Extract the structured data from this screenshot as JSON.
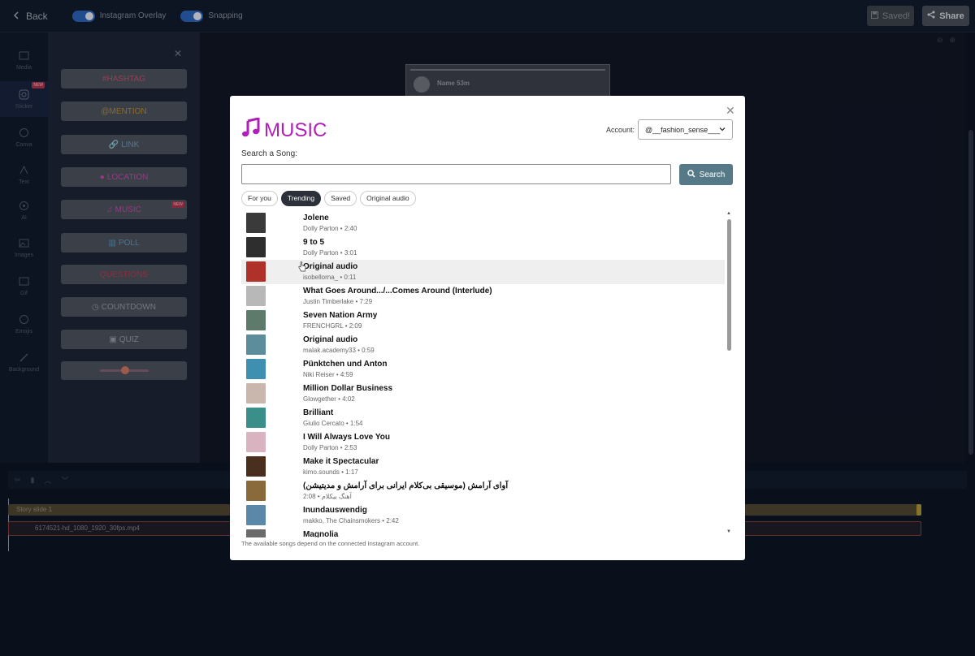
{
  "topbar": {
    "back_label": "Back",
    "instagram_overlay_label": "Instagram Overlay",
    "snapping_label": "Snapping",
    "saved_label": "Saved!",
    "share_label": "Share"
  },
  "rail": {
    "items": [
      {
        "label": "Media",
        "icon": "media-icon"
      },
      {
        "label": "Sticker",
        "icon": "sticker-icon",
        "badge": "NEW"
      },
      {
        "label": "Canva",
        "icon": "canva-icon"
      },
      {
        "label": "Text",
        "icon": "text-icon"
      },
      {
        "label": "AI",
        "icon": "ai-icon"
      },
      {
        "label": "Images",
        "icon": "images-icon"
      },
      {
        "label": "Gif",
        "icon": "gif-icon"
      },
      {
        "label": "Emojis",
        "icon": "emoji-icon"
      },
      {
        "label": "Background",
        "icon": "brush-icon"
      }
    ]
  },
  "stickers": {
    "hashtag": "#HASHTAG",
    "mention": "@MENTION",
    "link": "LINK",
    "location": "LOCATION",
    "music": "MUSIC",
    "music_badge": "NEW",
    "poll": "POLL",
    "questions": "QUESTIONS",
    "countdown": "COUNTDOWN",
    "quiz": "QUIZ"
  },
  "canvas": {
    "story_name": "Name 53m"
  },
  "timeline": {
    "track1_label": "Story slide 1",
    "track2_label": "6174521-hd_1080_1920_30fps.mp4"
  },
  "modal": {
    "title": "MUSIC",
    "account_label": "Account:",
    "account_value": "@__fashion_sense___",
    "search_label": "Search a Song:",
    "search_placeholder": "",
    "search_button": "Search",
    "tabs": [
      "For you",
      "Trending",
      "Saved",
      "Original audio"
    ],
    "active_tab": "Trending",
    "songs": [
      {
        "title": "Jolene",
        "sub": "Dolly Parton • 2:40",
        "thumb": "#3a3a3a"
      },
      {
        "title": "9 to 5",
        "sub": "Dolly Parton • 3:01",
        "thumb": "#2e2e2e"
      },
      {
        "title": "Original audio",
        "sub": "isobellorna_ • 0:11",
        "thumb": "#b0302a"
      },
      {
        "title": "What Goes Around.../...Comes Around (Interlude)",
        "sub": "Justin Timberlake • 7:29",
        "thumb": "#b8b8b8"
      },
      {
        "title": "Seven Nation Army",
        "sub": "FRENCHGRL • 2:09",
        "thumb": "#5e7a6a"
      },
      {
        "title": "Original audio",
        "sub": "malak.academy33 • 0:59",
        "thumb": "#5b8e9a"
      },
      {
        "title": "Pünktchen und Anton",
        "sub": "Niki Reiser • 4:59",
        "thumb": "#3e8fb0"
      },
      {
        "title": "Million Dollar Business",
        "sub": "Glowgether • 4:02",
        "thumb": "#c9b7ae"
      },
      {
        "title": "Brilliant",
        "sub": "Giulio Cercato • 1:54",
        "thumb": "#3b8f8a"
      },
      {
        "title": "I Will Always Love You",
        "sub": "Dolly Parton • 2:53",
        "thumb": "#d9b3bf"
      },
      {
        "title": "Make it Spectacular",
        "sub": "kimo.sounds • 1:17",
        "thumb": "#4a2e1e"
      },
      {
        "title": "آوای آرامش (موسیقی بی‌کلام ایرانی برای آرامش و مدیتیشن)",
        "sub": "2:08 • آهنگ بیکلام",
        "thumb": "#8a6a3a"
      },
      {
        "title": "Inundauswendig",
        "sub": "makko, The Chainsmokers • 2:42",
        "thumb": "#5b88a8"
      },
      {
        "title": "Magnolia",
        "sub": "",
        "thumb": "#6b6b6b"
      }
    ],
    "footnote": "The available songs depend on the connected Instagram account."
  }
}
